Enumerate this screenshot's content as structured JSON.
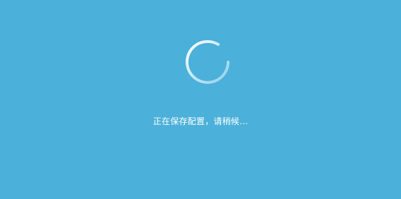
{
  "status": {
    "message": "正在保存配置，请稍候...",
    "icon": "loading-spinner-icon"
  },
  "colors": {
    "background": "#4BB0DA",
    "ring_start": "#ffffff",
    "ring_end": "#8ED0EC",
    "text": "#ffffff"
  }
}
